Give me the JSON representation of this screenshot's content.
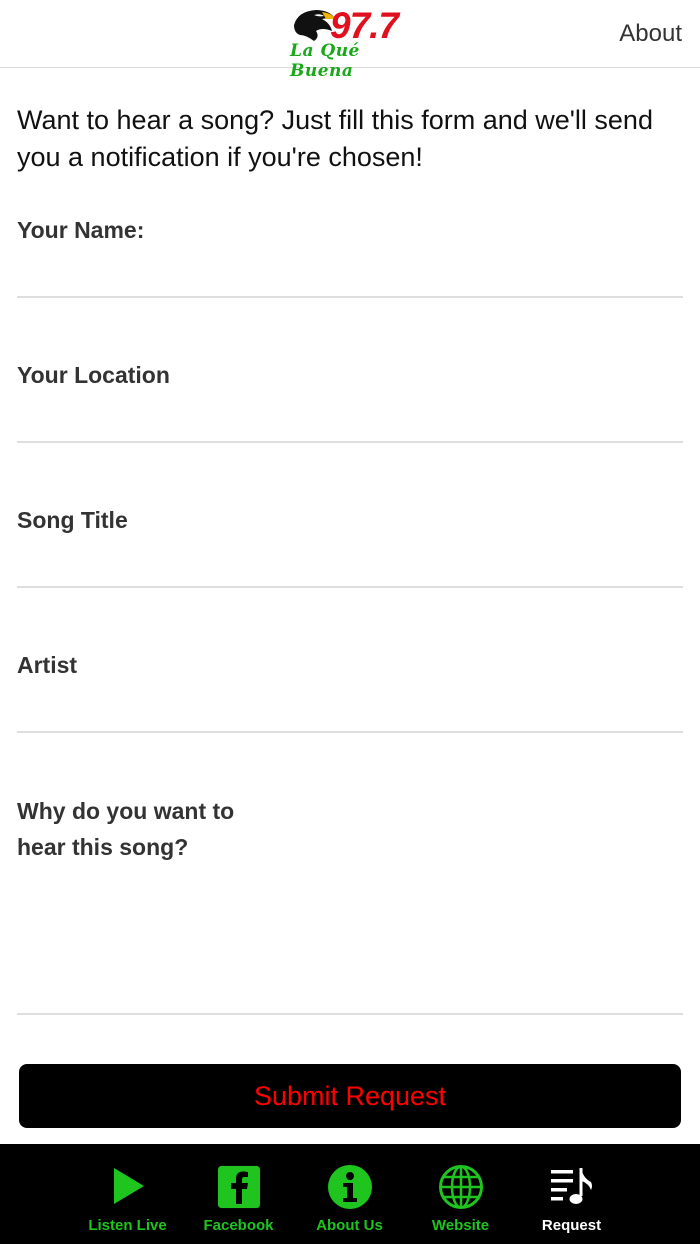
{
  "header": {
    "logo": {
      "number": "97.7",
      "script": "La Qué Buena"
    },
    "about_label": "About"
  },
  "intro": "Want to hear a song? Just fill this form and we'll send you a notification if you're chosen!",
  "form": {
    "fields": [
      {
        "label": "Your Name:",
        "value": ""
      },
      {
        "label": "Your Location",
        "value": ""
      },
      {
        "label": "Song Title",
        "value": ""
      },
      {
        "label": "Artist",
        "value": ""
      },
      {
        "label": "Why do you want to hear this song?",
        "value": ""
      }
    ],
    "submit_label": "Submit Request"
  },
  "tabbar": {
    "items": [
      {
        "label": "Listen Live",
        "icon": "play-icon"
      },
      {
        "label": "Facebook",
        "icon": "facebook-icon"
      },
      {
        "label": "About Us",
        "icon": "info-icon"
      },
      {
        "label": "Website",
        "icon": "globe-icon"
      },
      {
        "label": "Request",
        "icon": "music-list-icon",
        "active": true
      }
    ]
  },
  "colors": {
    "accent_green": "#1fc41f",
    "submit_text": "#ff0000",
    "tabbar_bg": "#000000",
    "logo_red": "#e0101f"
  }
}
